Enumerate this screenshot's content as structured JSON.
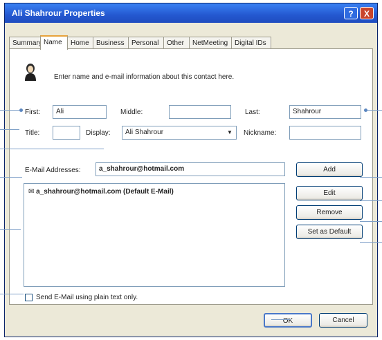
{
  "window": {
    "title": "Ali Shahrour Properties",
    "help_button": "?",
    "close_button": "X"
  },
  "tabs": [
    "Summary",
    "Name",
    "Home",
    "Business",
    "Personal",
    "Other",
    "NetMeeting",
    "Digital IDs"
  ],
  "active_tab": "Name",
  "intro": {
    "icon": "contact-person-icon",
    "text": "Enter name and e-mail information about this contact here."
  },
  "name_fields": {
    "first_label": "First:",
    "first_value": "Ali",
    "middle_label": "Middle:",
    "middle_value": "",
    "last_label": "Last:",
    "last_value": "Shahrour",
    "title_label": "Title:",
    "title_value": "",
    "display_label": "Display:",
    "display_value": "Ali Shahrour",
    "nickname_label": "Nickname:",
    "nickname_value": ""
  },
  "email": {
    "label": "E-Mail Addresses:",
    "input_value": "a_shahrour@hotmail.com",
    "list_item": "a_shahrour@hotmail.com (Default E-Mail)"
  },
  "buttons": {
    "add": "Add",
    "edit": "Edit",
    "remove": "Remove",
    "set_default": "Set as Default",
    "ok": "OK",
    "cancel": "Cancel"
  },
  "plain_text_option": {
    "label": "Send E-Mail using plain text only.",
    "checked": false
  },
  "colors": {
    "titlebar": "#2458D0",
    "dialog_face": "#ECE9D8",
    "field_border": "#7F9DB9",
    "active_tab_accent": "#E8A23A"
  }
}
